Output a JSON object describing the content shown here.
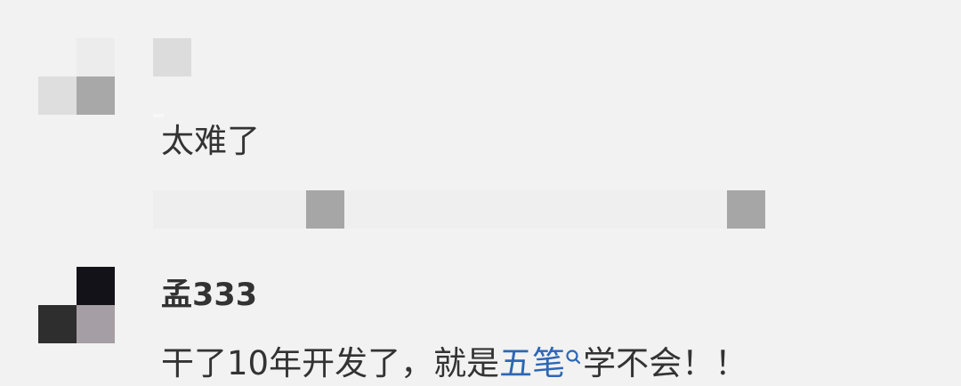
{
  "comments": [
    {
      "username": "",
      "text": "太难了"
    },
    {
      "username": "孟333",
      "text_before": "干了10年开发了，就是",
      "link_text": "五笔",
      "text_after": "学不会！！"
    }
  ],
  "colors": {
    "background": "#f2f2f2",
    "text": "#333333",
    "link": "#2c67b5",
    "mosaic_light": "#dcdcdc",
    "mosaic_mid": "#a6a6a6",
    "mosaic_dark": "#131218"
  },
  "icons": [
    "search-icon"
  ]
}
